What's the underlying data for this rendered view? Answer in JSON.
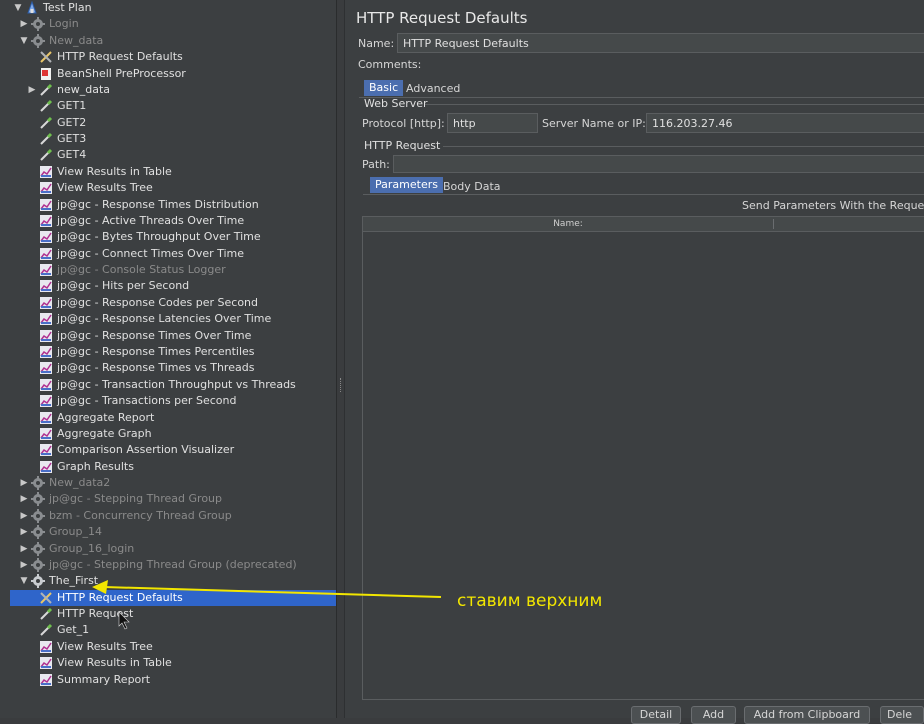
{
  "tree": [
    {
      "depth": 0,
      "arrow": "down",
      "icon": "testplan",
      "label": "Test Plan",
      "disabled": false,
      "selected": false
    },
    {
      "depth": 1,
      "arrow": "right",
      "icon": "gear",
      "label": "Login",
      "disabled": true,
      "selected": false
    },
    {
      "depth": 1,
      "arrow": "down",
      "icon": "gear",
      "label": "New_data",
      "disabled": true,
      "selected": false
    },
    {
      "depth": 2,
      "arrow": "",
      "icon": "tools",
      "label": "HTTP Request Defaults",
      "disabled": false,
      "selected": false
    },
    {
      "depth": 2,
      "arrow": "",
      "icon": "beanshell",
      "label": "BeanShell PreProcessor",
      "disabled": false,
      "selected": false
    },
    {
      "depth": 2,
      "arrow": "right",
      "icon": "pipette",
      "label": "new_data",
      "disabled": false,
      "selected": false
    },
    {
      "depth": 2,
      "arrow": "",
      "icon": "pipette",
      "label": "GET1",
      "disabled": false,
      "selected": false
    },
    {
      "depth": 2,
      "arrow": "",
      "icon": "pipette",
      "label": "GET2",
      "disabled": false,
      "selected": false
    },
    {
      "depth": 2,
      "arrow": "",
      "icon": "pipette",
      "label": "GET3",
      "disabled": false,
      "selected": false
    },
    {
      "depth": 2,
      "arrow": "",
      "icon": "pipette",
      "label": "GET4",
      "disabled": false,
      "selected": false
    },
    {
      "depth": 2,
      "arrow": "",
      "icon": "graph",
      "label": "View Results in Table",
      "disabled": false,
      "selected": false
    },
    {
      "depth": 2,
      "arrow": "",
      "icon": "graph",
      "label": "View Results Tree",
      "disabled": false,
      "selected": false
    },
    {
      "depth": 2,
      "arrow": "",
      "icon": "graph",
      "label": "jp@gc - Response Times Distribution",
      "disabled": false,
      "selected": false
    },
    {
      "depth": 2,
      "arrow": "",
      "icon": "graph",
      "label": "jp@gc - Active Threads Over Time",
      "disabled": false,
      "selected": false
    },
    {
      "depth": 2,
      "arrow": "",
      "icon": "graph",
      "label": "jp@gc - Bytes Throughput Over Time",
      "disabled": false,
      "selected": false
    },
    {
      "depth": 2,
      "arrow": "",
      "icon": "graph",
      "label": "jp@gc - Connect Times Over Time",
      "disabled": false,
      "selected": false
    },
    {
      "depth": 2,
      "arrow": "",
      "icon": "graph",
      "label": "jp@gc - Console Status Logger",
      "disabled": true,
      "selected": false
    },
    {
      "depth": 2,
      "arrow": "",
      "icon": "graph",
      "label": "jp@gc - Hits per Second",
      "disabled": false,
      "selected": false
    },
    {
      "depth": 2,
      "arrow": "",
      "icon": "graph",
      "label": "jp@gc - Response Codes per Second",
      "disabled": false,
      "selected": false
    },
    {
      "depth": 2,
      "arrow": "",
      "icon": "graph",
      "label": "jp@gc - Response Latencies Over Time",
      "disabled": false,
      "selected": false
    },
    {
      "depth": 2,
      "arrow": "",
      "icon": "graph",
      "label": "jp@gc - Response Times Over Time",
      "disabled": false,
      "selected": false
    },
    {
      "depth": 2,
      "arrow": "",
      "icon": "graph",
      "label": "jp@gc - Response Times Percentiles",
      "disabled": false,
      "selected": false
    },
    {
      "depth": 2,
      "arrow": "",
      "icon": "graph",
      "label": "jp@gc - Response Times vs Threads",
      "disabled": false,
      "selected": false
    },
    {
      "depth": 2,
      "arrow": "",
      "icon": "graph",
      "label": "jp@gc - Transaction Throughput vs Threads",
      "disabled": false,
      "selected": false
    },
    {
      "depth": 2,
      "arrow": "",
      "icon": "graph",
      "label": "jp@gc - Transactions per Second",
      "disabled": false,
      "selected": false
    },
    {
      "depth": 2,
      "arrow": "",
      "icon": "graph",
      "label": "Aggregate Report",
      "disabled": false,
      "selected": false
    },
    {
      "depth": 2,
      "arrow": "",
      "icon": "graph",
      "label": "Aggregate Graph",
      "disabled": false,
      "selected": false
    },
    {
      "depth": 2,
      "arrow": "",
      "icon": "graph",
      "label": "Comparison Assertion Visualizer",
      "disabled": false,
      "selected": false
    },
    {
      "depth": 2,
      "arrow": "",
      "icon": "graph",
      "label": "Graph Results",
      "disabled": false,
      "selected": false
    },
    {
      "depth": 1,
      "arrow": "right",
      "icon": "gear",
      "label": "New_data2",
      "disabled": true,
      "selected": false
    },
    {
      "depth": 1,
      "arrow": "right",
      "icon": "gear",
      "label": "jp@gc - Stepping Thread Group",
      "disabled": true,
      "selected": false
    },
    {
      "depth": 1,
      "arrow": "right",
      "icon": "gear",
      "label": "bzm - Concurrency Thread Group",
      "disabled": true,
      "selected": false
    },
    {
      "depth": 1,
      "arrow": "right",
      "icon": "gear",
      "label": "Group_14",
      "disabled": true,
      "selected": false
    },
    {
      "depth": 1,
      "arrow": "right",
      "icon": "gear",
      "label": "Group_16_login",
      "disabled": true,
      "selected": false
    },
    {
      "depth": 1,
      "arrow": "right",
      "icon": "gear",
      "label": "jp@gc - Stepping Thread Group (deprecated)",
      "disabled": true,
      "selected": false
    },
    {
      "depth": 1,
      "arrow": "down",
      "icon": "gear-active",
      "label": "The_First",
      "disabled": false,
      "selected": false
    },
    {
      "depth": 2,
      "arrow": "",
      "icon": "tools",
      "label": "HTTP Request Defaults",
      "disabled": false,
      "selected": true
    },
    {
      "depth": 2,
      "arrow": "",
      "icon": "pipette",
      "label": "HTTP Request",
      "disabled": false,
      "selected": false
    },
    {
      "depth": 2,
      "arrow": "",
      "icon": "pipette",
      "label": "Get_1",
      "disabled": false,
      "selected": false
    },
    {
      "depth": 2,
      "arrow": "",
      "icon": "graph",
      "label": "View Results Tree",
      "disabled": false,
      "selected": false
    },
    {
      "depth": 2,
      "arrow": "",
      "icon": "graph",
      "label": "View Results in Table",
      "disabled": false,
      "selected": false
    },
    {
      "depth": 2,
      "arrow": "",
      "icon": "graph",
      "label": "Summary Report",
      "disabled": false,
      "selected": false
    }
  ],
  "editor": {
    "title": "HTTP Request Defaults",
    "name_label": "Name:",
    "name_value": "HTTP Request Defaults",
    "comments_label": "Comments:",
    "comments_value": "",
    "tabs": {
      "basic": "Basic",
      "advanced": "Advanced"
    },
    "web_server_title": "Web Server",
    "protocol_label": "Protocol [http]:",
    "protocol_value": "http",
    "server_label": "Server Name or IP:",
    "server_value": "116.203.27.46",
    "http_request_title": "HTTP Request",
    "path_label": "Path:",
    "path_value": "",
    "param_tabs": {
      "parameters": "Parameters",
      "body": "Body Data"
    },
    "send_params_label": "Send Parameters With the Request",
    "column_name": "Name:",
    "buttons": {
      "detail": "Detail",
      "add": "Add",
      "add_clipboard": "Add from Clipboard",
      "delete": "Dele"
    }
  },
  "annotation": {
    "text": "ставим верхним",
    "color": "#f2e600"
  },
  "colors": {
    "selection": "#2f65ca",
    "panel": "#3c3f41",
    "tab_active": "#4b6eaf"
  }
}
